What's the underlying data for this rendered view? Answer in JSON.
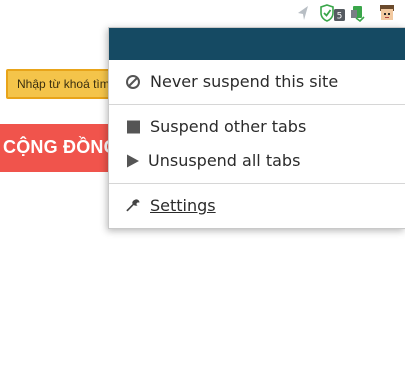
{
  "toolbar": {
    "extensions": [
      {
        "icon": "navigation-arrow-icon"
      },
      {
        "icon": "shield-badge-icon",
        "badge": "5"
      },
      {
        "icon": "padlock-extension-icon"
      },
      {
        "icon": "suspender-face-icon"
      }
    ]
  },
  "page": {
    "search_placeholder": "Nhập từ khoá tìm",
    "community_label": "CỘNG ĐỒNG"
  },
  "menu": {
    "header_color": "#154a63",
    "never_suspend": "Never suspend this site",
    "suspend_other": "Suspend other tabs",
    "unsuspend_all": "Unsuspend all tabs",
    "settings": "Settings"
  },
  "colors": {
    "banner": "#f0544c",
    "search_bg": "#f4c44a",
    "shield_green": "#3aa64a"
  }
}
